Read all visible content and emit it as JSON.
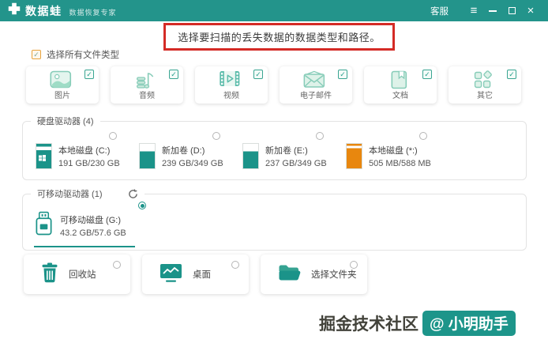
{
  "window": {
    "app_name": "数据蛙",
    "app_subtitle": "数据恢复专家",
    "support": "客服"
  },
  "icons": {
    "check": "✓",
    "menu": "≡",
    "close": "×"
  },
  "headline": "选择要扫描的丢失数据的数据类型和路径。",
  "select_all": {
    "label": "选择所有文件类型",
    "checked": true
  },
  "file_types": [
    {
      "label": "图片",
      "checked": true
    },
    {
      "label": "音频",
      "checked": true
    },
    {
      "label": "视频",
      "checked": true
    },
    {
      "label": "电子邮件",
      "checked": true
    },
    {
      "label": "文档",
      "checked": true
    },
    {
      "label": "其它",
      "checked": true
    }
  ],
  "hard_drives": {
    "title": "硬盘驱动器 (4)",
    "items": [
      {
        "name": "本地磁盘 (C:)",
        "capacity": "191 GB/230 GB",
        "selected": false,
        "color": "#1B9389"
      },
      {
        "name": "新加卷 (D:)",
        "capacity": "239 GB/349 GB",
        "selected": false,
        "color": "#1B9389"
      },
      {
        "name": "新加卷 (E:)",
        "capacity": "237 GB/349 GB",
        "selected": false,
        "color": "#1B9389"
      },
      {
        "name": "本地磁盘 (*:)",
        "capacity": "505 MB/588 MB",
        "selected": false,
        "color": "#E8870E"
      }
    ]
  },
  "removable_drives": {
    "title": "可移动驱动器 (1)",
    "items": [
      {
        "name": "可移动磁盘 (G:)",
        "capacity": "43.2 GB/57.6 GB",
        "selected": true
      }
    ]
  },
  "locations": [
    {
      "label": "回收站",
      "selected": false
    },
    {
      "label": "桌面",
      "selected": false
    },
    {
      "label": "选择文件夹",
      "selected": false
    }
  ],
  "watermark": {
    "text": "掘金技术社区",
    "badge": "@ 小明助手"
  },
  "colors": {
    "header_teal": "#23948B",
    "icon_teal": "#1B9389",
    "drive_orange": "#E8870E",
    "annotation_red": "#D42B26",
    "select_all_orange": "#E8A33D"
  }
}
